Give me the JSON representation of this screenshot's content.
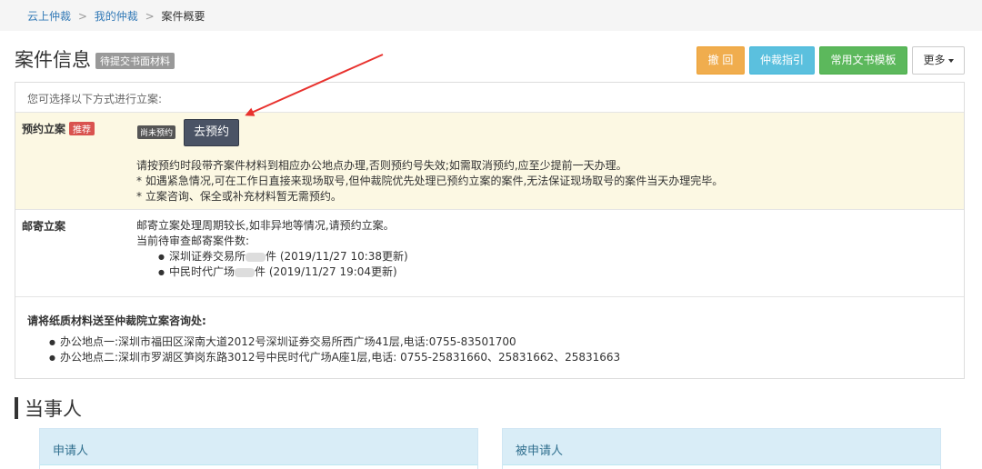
{
  "breadcrumb": {
    "home": "云上仲裁",
    "mine": "我的仲裁",
    "current": "案件概要",
    "separator": ">"
  },
  "header": {
    "title": "案件信息",
    "status": "待提交书面材料",
    "buttons": {
      "withdraw": "撤 回",
      "guide": "仲裁指引",
      "templates": "常用文书模板",
      "more": "更多"
    }
  },
  "filing": {
    "intro": "您可选择以下方式进行立案:",
    "appointment": {
      "label": "预约立案",
      "badge": "推荐",
      "pending": "尚未预约",
      "book_button": "去预约",
      "lines": [
        "请按预约时段带齐案件材料到相应办公地点办理,否则预约号失效;如需取消预约,应至少提前一天办理。",
        "* 如遇紧急情况,可在工作日直接来现场取号,但仲裁院优先处理已预约立案的案件,无法保证现场取号的案件当天办理完毕。",
        "* 立案咨询、保全或补充材料暂无需预约。"
      ]
    },
    "mail": {
      "label": "邮寄立案",
      "line1": "邮寄立案处理周期较长,如非异地等情况,请预约立案。",
      "line2": "当前待审查邮寄案件数:",
      "items": [
        {
          "place": "深圳证券交易所",
          "suffix": "件 (2019/11/27 10:38更新)"
        },
        {
          "place": "中民时代广场",
          "suffix": "件 (2019/11/27 19:04更新)"
        }
      ]
    },
    "paper": {
      "title": "请将纸质材料送至仲裁院立案咨询处:",
      "offices": [
        "办公地点一:深圳市福田区深南大道2012号深圳证券交易所西广场41层,电话:0755-83501700",
        "办公地点二:深圳市罗湖区笋岗东路3012号中民时代广场A座1层,电话: 0755-25831660、25831662、25831663"
      ]
    }
  },
  "parties": {
    "title": "当事人",
    "applicant": "申请人",
    "respondent": "被申请人"
  },
  "colors": {
    "accent_arrow": "#e8322e",
    "warning": "#f0ad4e",
    "info": "#5bc0de",
    "success": "#5cb85c",
    "highlight_row": "#fcf8e3"
  }
}
